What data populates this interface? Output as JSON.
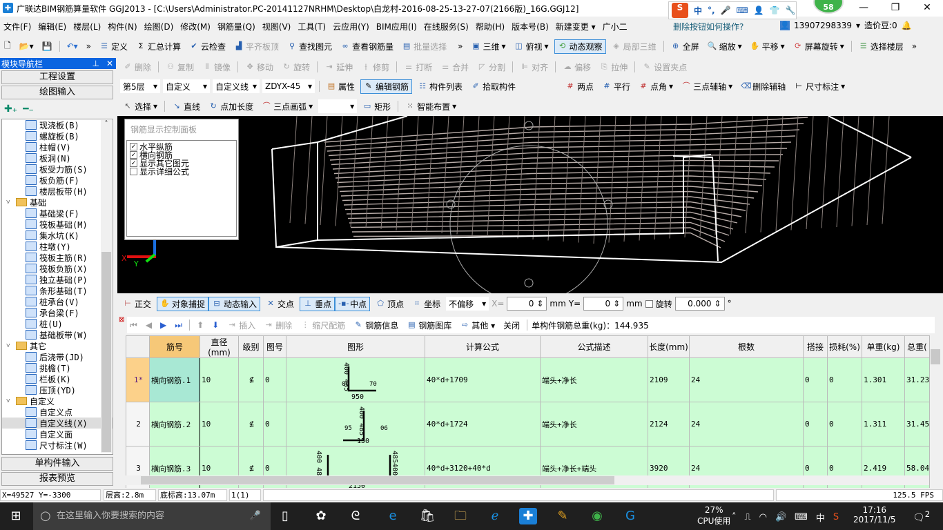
{
  "title": "广联达BIM钢筋算量软件 GGJ2013 - [C:\\Users\\Administrator.PC-20141127NRHM\\Desktop\\白龙村-2016-08-25-13-27-07(2166版)_16G.GGJ12]",
  "ime": {
    "s": "S",
    "items": [
      "中",
      "°,",
      "mic",
      "kbd",
      "user",
      "shirt",
      "wrench"
    ]
  },
  "badge": "58",
  "window": {
    "min": "—",
    "max": "❐",
    "close": "✕"
  },
  "menu": [
    "文件(F)",
    "编辑(E)",
    "楼层(L)",
    "构件(N)",
    "绘图(D)",
    "修改(M)",
    "钢筋量(Q)",
    "视图(V)",
    "工具(T)",
    "云应用(Y)",
    "BIM应用(I)",
    "在线服务(S)",
    "帮助(H)",
    "版本号(B)",
    "新建变更 ▾",
    "广小二"
  ],
  "help_link": "删除按钮如何操作?",
  "account": {
    "phone": "13907298339",
    "beans": "造价豆:0"
  },
  "toolbar1": {
    "left": [
      "定义",
      "汇总计算",
      "云检查",
      "平齐板顶",
      "查找图元",
      "查看钢筋量",
      "批量选择"
    ],
    "right": [
      "三维",
      "俯视",
      "动态观察",
      "局部三维",
      "全屏",
      "缩放",
      "平移",
      "屏幕旋转",
      "选择楼层"
    ]
  },
  "toolbar_edit": [
    "删除",
    "复制",
    "镜像",
    "移动",
    "旋转",
    "延伸",
    "修剪",
    "打断",
    "合并",
    "分割",
    "对齐",
    "偏移",
    "拉伸",
    "设置夹点"
  ],
  "layer_bar": {
    "floor": "第5层",
    "type": "自定义",
    "subtype": "自定义线",
    "name": "ZDYX-45",
    "buttons": [
      "属性",
      "编辑钢筋",
      "构件列表",
      "拾取构件"
    ]
  },
  "axis_bar": [
    "两点",
    "平行",
    "点角",
    "三点辅轴",
    "删除辅轴",
    "尺寸标注"
  ],
  "draw_bar": {
    "select": "选择",
    "buttons": [
      "直线",
      "点加长度",
      "三点画弧",
      "矩形",
      "智能布置"
    ]
  },
  "nav": {
    "title": "模块导航栏",
    "pin": "📌",
    "close": "✕",
    "project": "工程设置",
    "draw": "绘图输入",
    "single": "单构件输入",
    "report": "报表预览",
    "tree": [
      {
        "label": "现浇板(B)",
        "lvl": 2
      },
      {
        "label": "螺旋板(B)",
        "lvl": 2
      },
      {
        "label": "柱帽(V)",
        "lvl": 2
      },
      {
        "label": "板洞(N)",
        "lvl": 2
      },
      {
        "label": "板受力筋(S)",
        "lvl": 2
      },
      {
        "label": "板负筋(F)",
        "lvl": 2
      },
      {
        "label": "楼层板带(H)",
        "lvl": 2
      },
      {
        "label": "基础",
        "lvl": 1
      },
      {
        "label": "基础梁(F)",
        "lvl": 2
      },
      {
        "label": "筏板基础(M)",
        "lvl": 2
      },
      {
        "label": "集水坑(K)",
        "lvl": 2
      },
      {
        "label": "柱墩(Y)",
        "lvl": 2
      },
      {
        "label": "筏板主筋(R)",
        "lvl": 2
      },
      {
        "label": "筏板负筋(X)",
        "lvl": 2
      },
      {
        "label": "独立基础(P)",
        "lvl": 2
      },
      {
        "label": "条形基础(T)",
        "lvl": 2
      },
      {
        "label": "桩承台(V)",
        "lvl": 2
      },
      {
        "label": "承台梁(F)",
        "lvl": 2
      },
      {
        "label": "桩(U)",
        "lvl": 2
      },
      {
        "label": "基础板带(W)",
        "lvl": 2
      },
      {
        "label": "其它",
        "lvl": 1
      },
      {
        "label": "后浇带(JD)",
        "lvl": 2
      },
      {
        "label": "挑檐(T)",
        "lvl": 2
      },
      {
        "label": "栏板(K)",
        "lvl": 2
      },
      {
        "label": "压顶(YD)",
        "lvl": 2
      },
      {
        "label": "自定义",
        "lvl": 1
      },
      {
        "label": "自定义点",
        "lvl": 2
      },
      {
        "label": "自定义线(X)",
        "lvl": 2,
        "selected": true
      },
      {
        "label": "自定义面",
        "lvl": 2
      },
      {
        "label": "尺寸标注(W)",
        "lvl": 2
      }
    ]
  },
  "rebar_panel": {
    "title": "钢筋显示控制面板",
    "options": [
      {
        "label": "水平纵筋",
        "checked": true
      },
      {
        "label": "横向钢筋",
        "checked": true
      },
      {
        "label": "显示其它图元",
        "checked": true
      },
      {
        "label": "显示详细公式",
        "checked": false
      }
    ]
  },
  "axes": {
    "x": "X",
    "y": "Y"
  },
  "snap_bar": {
    "buttons": [
      "正交",
      "对象捕捉",
      "动态输入",
      "交点",
      "垂点",
      "中点",
      "顶点",
      "坐标"
    ],
    "offset": "不偏移",
    "x_label": "X=",
    "x": "0",
    "y_label": "Y=",
    "y": "0",
    "unit": "mm",
    "rotate": "旋转",
    "angle": "0.000",
    "deg": "°"
  },
  "grid_bar": {
    "buttons": [
      "插入",
      "删除",
      "缩尺配筋",
      "钢筋信息",
      "钢筋图库",
      "其他 ▾",
      "关闭"
    ],
    "total": "单构件钢筋总重(kg)：144.935"
  },
  "table": {
    "headers": [
      "",
      "筋号",
      "直径(mm)",
      "级别",
      "图号",
      "图形",
      "计算公式",
      "公式描述",
      "长度(mm)",
      "根数",
      "搭接",
      "损耗(%)",
      "单重(kg)",
      "总重("
    ],
    "rows": [
      {
        "no": "1*",
        "name": "横向钢筋.1",
        "dia": "10",
        "grade": "⊈",
        "fig": "0",
        "shape": {
          "v": "400 485",
          "h": "950",
          "a": "70",
          "b": "06"
        },
        "formula": "40*d+1709",
        "desc": "端头+净长",
        "len": "2109",
        "count": "24",
        "lap": "0",
        "loss": "0",
        "unit": "1.301",
        "total": "31.23"
      },
      {
        "no": "2",
        "name": "横向钢筋.2",
        "dia": "10",
        "grade": "⊈",
        "fig": "0",
        "shape": {
          "v": "400 485",
          "h": "150",
          "a": "95",
          "b": "06"
        },
        "formula": "40*d+1724",
        "desc": "端头+净长",
        "len": "2124",
        "count": "24",
        "lap": "0",
        "loss": "0",
        "unit": "1.311",
        "total": "31.452"
      },
      {
        "no": "3",
        "name": "横向钢筋.3",
        "dia": "10",
        "grade": "⊈",
        "fig": "0",
        "shape": {
          "v": "400 485",
          "h": "2150",
          "a": "485400",
          "b": ""
        },
        "formula": "40*d+3120+40*d",
        "desc": "端头+净长+端头",
        "len": "3920",
        "count": "24",
        "lap": "0",
        "loss": "0",
        "unit": "2.419",
        "total": "58.047"
      }
    ]
  },
  "status": {
    "coords": "X=49527 Y=-3300",
    "floor_h": "层高:2.8m",
    "base_h": "底标高:13.07m",
    "count": "1(1)",
    "fps": "125.5 FPS"
  },
  "taskbar": {
    "search": "在这里输入你要搜索的内容",
    "cpu_pct": "27%",
    "cpu_label": "CPU使用",
    "ime": "中",
    "time": "17:16",
    "date": "2017/11/5",
    "notif": "2"
  }
}
